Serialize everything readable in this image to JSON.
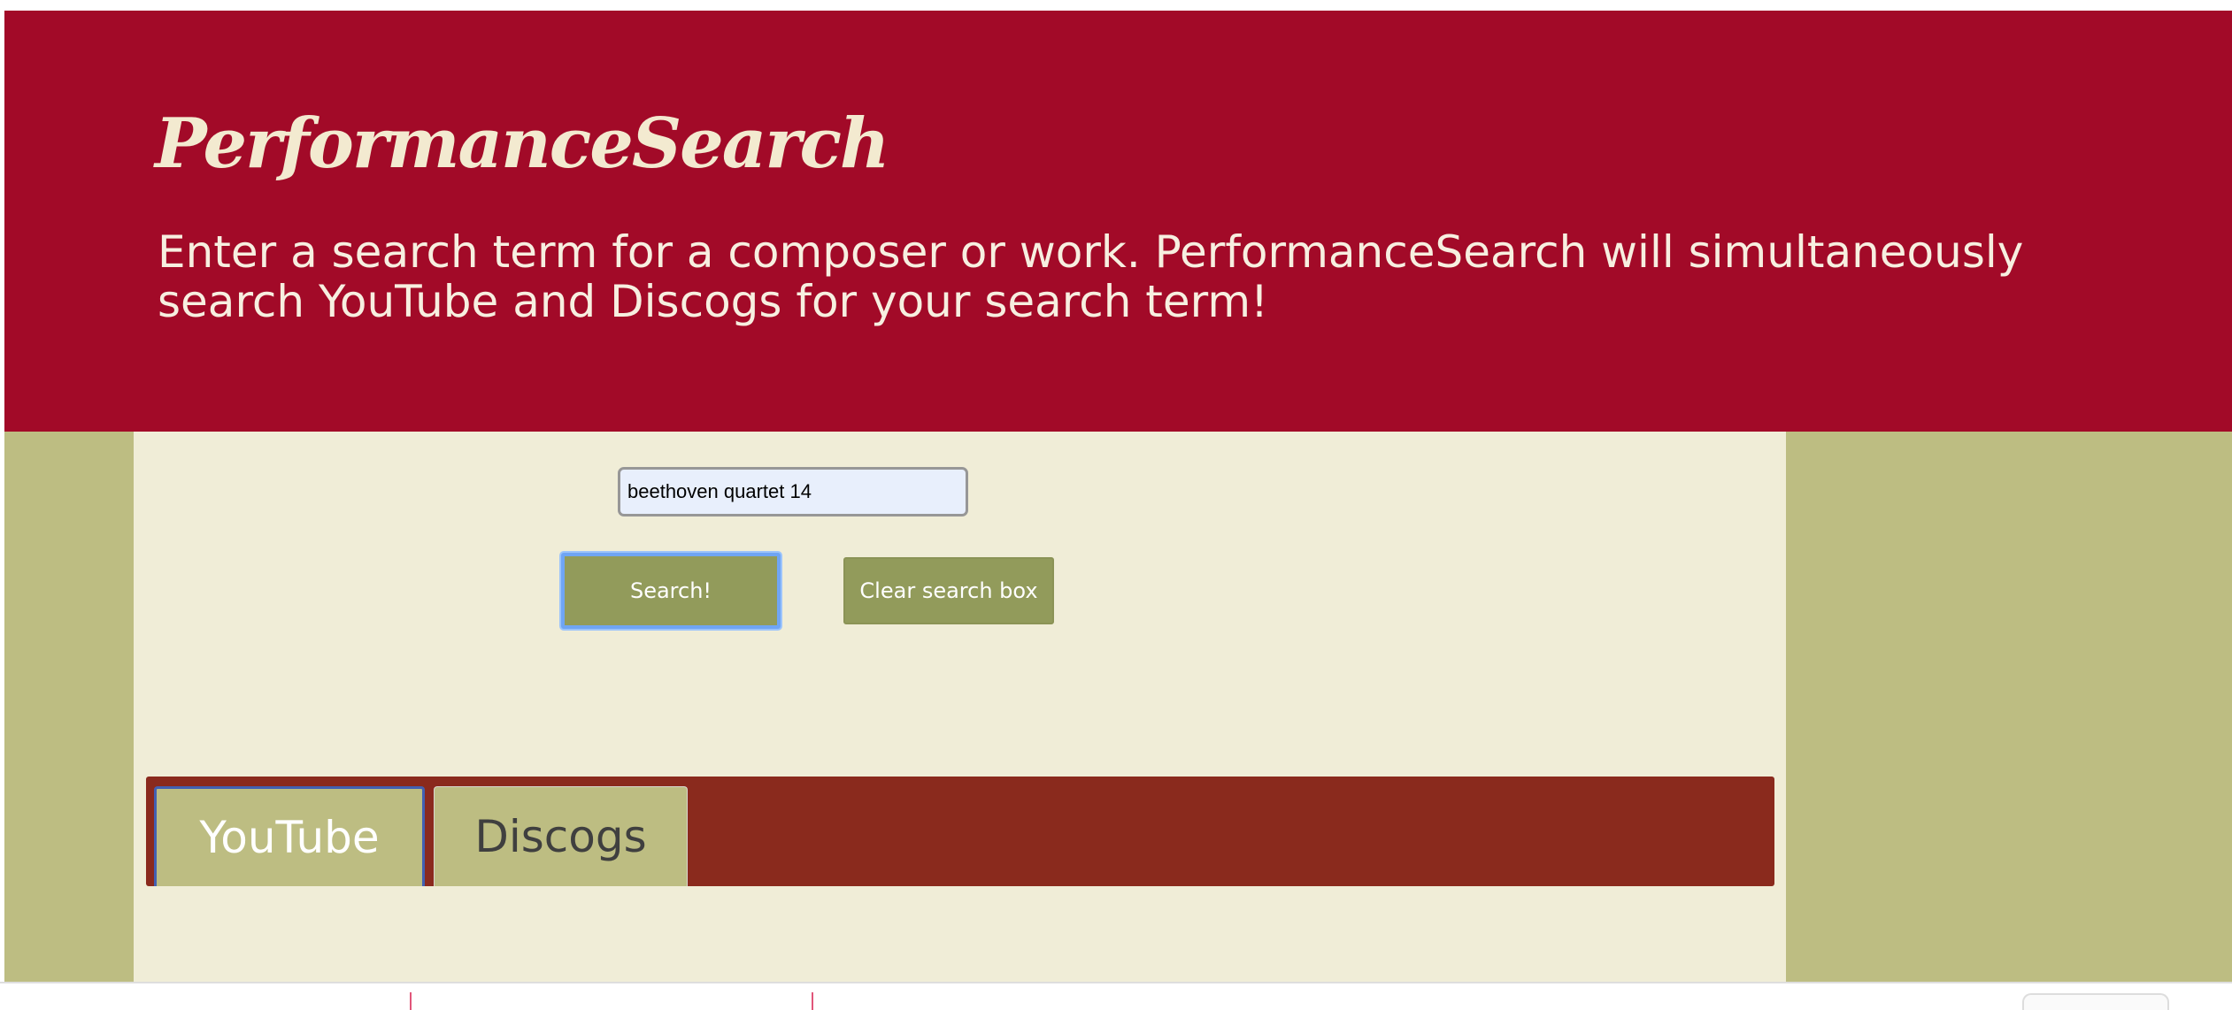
{
  "header": {
    "title": "PerformanceSearch",
    "subtitle": "Enter a search term for a composer or work. PerformanceSearch will simultaneously search YouTube and Discogs for your search term!"
  },
  "search": {
    "value": "beethoven quartet 14"
  },
  "buttons": {
    "search_label": "Search!",
    "clear_label": "Clear search box"
  },
  "tabs": [
    {
      "label": "YouTube",
      "active": true
    },
    {
      "label": "Discogs",
      "active": false
    }
  ],
  "colors": {
    "header_bg": "#a20a28",
    "panel_bg": "#f0edd7",
    "side_bg": "#bdbd82",
    "button_bg": "#929b5b",
    "tabbar_bg": "#8a2a1d",
    "title_text": "#f3ead0"
  }
}
